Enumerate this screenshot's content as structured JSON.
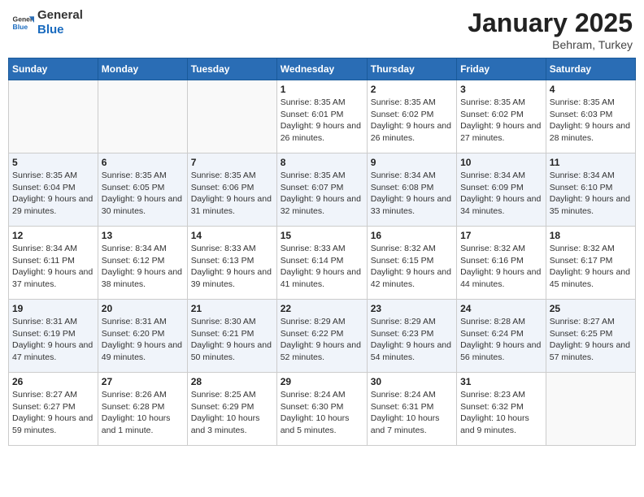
{
  "header": {
    "logo_line1": "General",
    "logo_line2": "Blue",
    "month": "January 2025",
    "location": "Behram, Turkey"
  },
  "weekdays": [
    "Sunday",
    "Monday",
    "Tuesday",
    "Wednesday",
    "Thursday",
    "Friday",
    "Saturday"
  ],
  "weeks": [
    [
      {
        "day": "",
        "info": ""
      },
      {
        "day": "",
        "info": ""
      },
      {
        "day": "",
        "info": ""
      },
      {
        "day": "1",
        "info": "Sunrise: 8:35 AM\nSunset: 6:01 PM\nDaylight: 9 hours and 26 minutes."
      },
      {
        "day": "2",
        "info": "Sunrise: 8:35 AM\nSunset: 6:02 PM\nDaylight: 9 hours and 26 minutes."
      },
      {
        "day": "3",
        "info": "Sunrise: 8:35 AM\nSunset: 6:02 PM\nDaylight: 9 hours and 27 minutes."
      },
      {
        "day": "4",
        "info": "Sunrise: 8:35 AM\nSunset: 6:03 PM\nDaylight: 9 hours and 28 minutes."
      }
    ],
    [
      {
        "day": "5",
        "info": "Sunrise: 8:35 AM\nSunset: 6:04 PM\nDaylight: 9 hours and 29 minutes."
      },
      {
        "day": "6",
        "info": "Sunrise: 8:35 AM\nSunset: 6:05 PM\nDaylight: 9 hours and 30 minutes."
      },
      {
        "day": "7",
        "info": "Sunrise: 8:35 AM\nSunset: 6:06 PM\nDaylight: 9 hours and 31 minutes."
      },
      {
        "day": "8",
        "info": "Sunrise: 8:35 AM\nSunset: 6:07 PM\nDaylight: 9 hours and 32 minutes."
      },
      {
        "day": "9",
        "info": "Sunrise: 8:34 AM\nSunset: 6:08 PM\nDaylight: 9 hours and 33 minutes."
      },
      {
        "day": "10",
        "info": "Sunrise: 8:34 AM\nSunset: 6:09 PM\nDaylight: 9 hours and 34 minutes."
      },
      {
        "day": "11",
        "info": "Sunrise: 8:34 AM\nSunset: 6:10 PM\nDaylight: 9 hours and 35 minutes."
      }
    ],
    [
      {
        "day": "12",
        "info": "Sunrise: 8:34 AM\nSunset: 6:11 PM\nDaylight: 9 hours and 37 minutes."
      },
      {
        "day": "13",
        "info": "Sunrise: 8:34 AM\nSunset: 6:12 PM\nDaylight: 9 hours and 38 minutes."
      },
      {
        "day": "14",
        "info": "Sunrise: 8:33 AM\nSunset: 6:13 PM\nDaylight: 9 hours and 39 minutes."
      },
      {
        "day": "15",
        "info": "Sunrise: 8:33 AM\nSunset: 6:14 PM\nDaylight: 9 hours and 41 minutes."
      },
      {
        "day": "16",
        "info": "Sunrise: 8:32 AM\nSunset: 6:15 PM\nDaylight: 9 hours and 42 minutes."
      },
      {
        "day": "17",
        "info": "Sunrise: 8:32 AM\nSunset: 6:16 PM\nDaylight: 9 hours and 44 minutes."
      },
      {
        "day": "18",
        "info": "Sunrise: 8:32 AM\nSunset: 6:17 PM\nDaylight: 9 hours and 45 minutes."
      }
    ],
    [
      {
        "day": "19",
        "info": "Sunrise: 8:31 AM\nSunset: 6:19 PM\nDaylight: 9 hours and 47 minutes."
      },
      {
        "day": "20",
        "info": "Sunrise: 8:31 AM\nSunset: 6:20 PM\nDaylight: 9 hours and 49 minutes."
      },
      {
        "day": "21",
        "info": "Sunrise: 8:30 AM\nSunset: 6:21 PM\nDaylight: 9 hours and 50 minutes."
      },
      {
        "day": "22",
        "info": "Sunrise: 8:29 AM\nSunset: 6:22 PM\nDaylight: 9 hours and 52 minutes."
      },
      {
        "day": "23",
        "info": "Sunrise: 8:29 AM\nSunset: 6:23 PM\nDaylight: 9 hours and 54 minutes."
      },
      {
        "day": "24",
        "info": "Sunrise: 8:28 AM\nSunset: 6:24 PM\nDaylight: 9 hours and 56 minutes."
      },
      {
        "day": "25",
        "info": "Sunrise: 8:27 AM\nSunset: 6:25 PM\nDaylight: 9 hours and 57 minutes."
      }
    ],
    [
      {
        "day": "26",
        "info": "Sunrise: 8:27 AM\nSunset: 6:27 PM\nDaylight: 9 hours and 59 minutes."
      },
      {
        "day": "27",
        "info": "Sunrise: 8:26 AM\nSunset: 6:28 PM\nDaylight: 10 hours and 1 minute."
      },
      {
        "day": "28",
        "info": "Sunrise: 8:25 AM\nSunset: 6:29 PM\nDaylight: 10 hours and 3 minutes."
      },
      {
        "day": "29",
        "info": "Sunrise: 8:24 AM\nSunset: 6:30 PM\nDaylight: 10 hours and 5 minutes."
      },
      {
        "day": "30",
        "info": "Sunrise: 8:24 AM\nSunset: 6:31 PM\nDaylight: 10 hours and 7 minutes."
      },
      {
        "day": "31",
        "info": "Sunrise: 8:23 AM\nSunset: 6:32 PM\nDaylight: 10 hours and 9 minutes."
      },
      {
        "day": "",
        "info": ""
      }
    ]
  ]
}
